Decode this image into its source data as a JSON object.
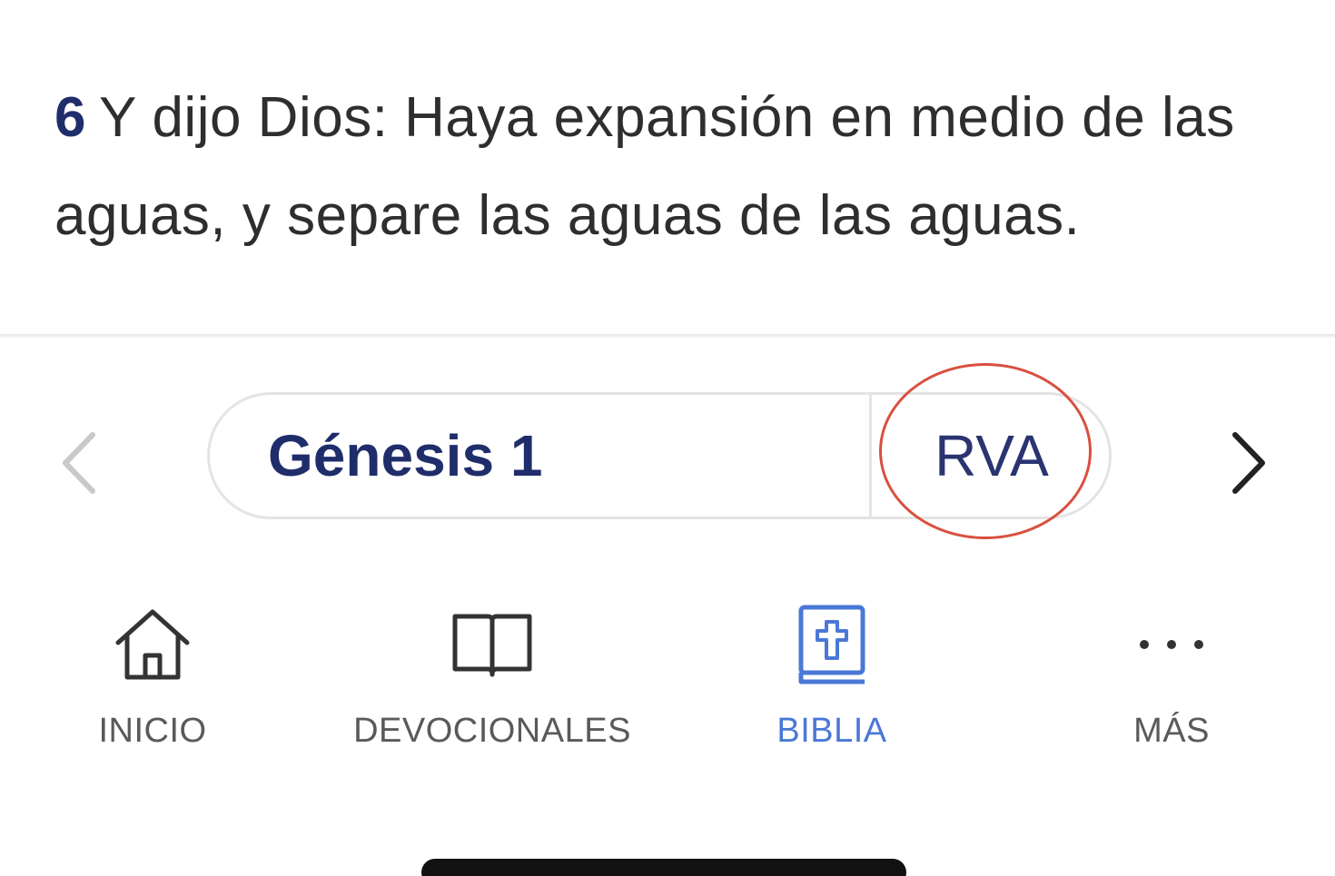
{
  "reader": {
    "verse_number": "6",
    "verse_text": "Y dijo Dios: Haya expansión en medio de las aguas, y separe las aguas de las aguas."
  },
  "chapter_nav": {
    "book_chapter": "Génesis 1",
    "version": "RVA",
    "prev_icon": "chevron-left-icon",
    "next_icon": "chevron-right-icon"
  },
  "tabs": [
    {
      "label": "INICIO",
      "icon": "home-icon",
      "active": false
    },
    {
      "label": "DEVOCIONALES",
      "icon": "open-book-icon",
      "active": false
    },
    {
      "label": "BIBLIA",
      "icon": "bible-icon",
      "active": true
    },
    {
      "label": "MÁS",
      "icon": "more-dots-icon",
      "active": false
    }
  ],
  "colors": {
    "accent": "#4a78d8",
    "verse_number": "#1f2d6b",
    "highlight_ring": "#d9503f"
  }
}
